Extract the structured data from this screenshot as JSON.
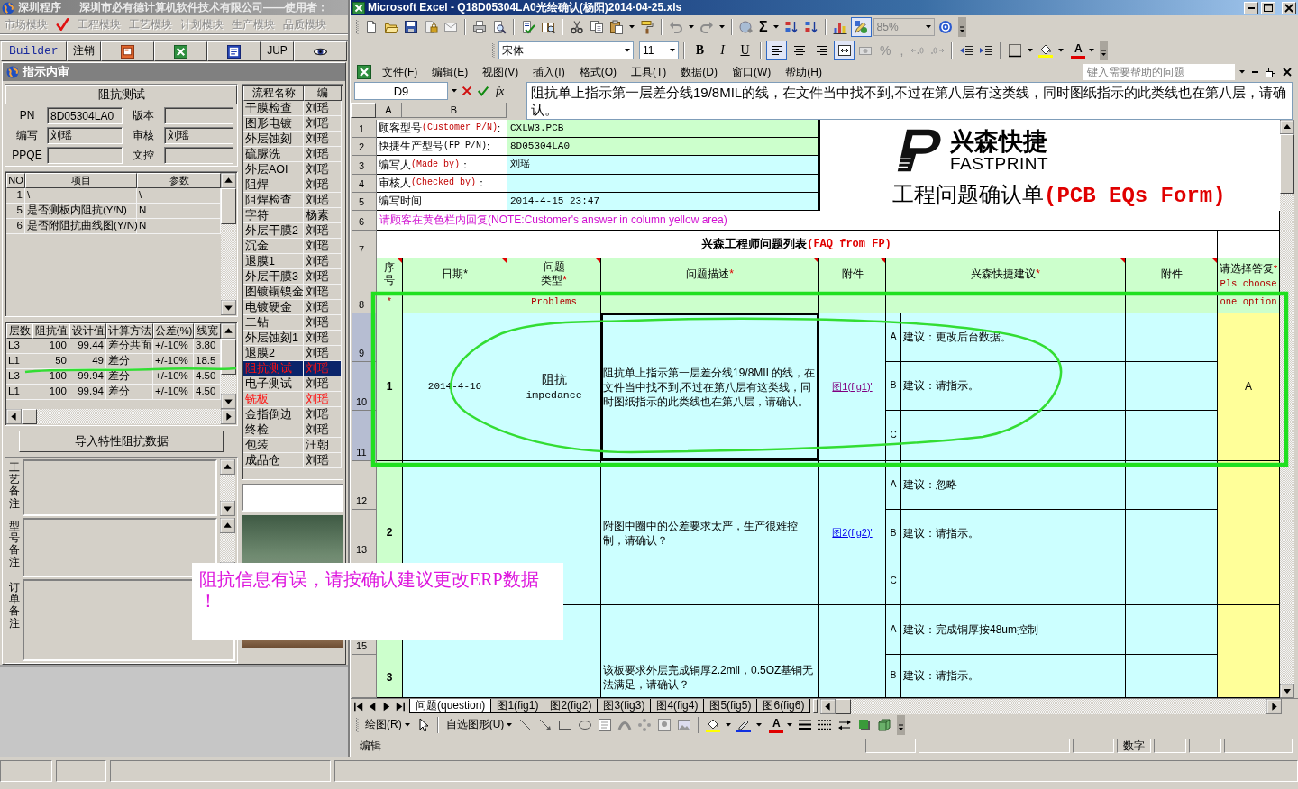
{
  "erp": {
    "title": {
      "app": "深圳程序",
      "company": "深圳市必有德计算机软件技术有限公司——使用者："
    },
    "modules": [
      {
        "label": "市场模块",
        "checked": false
      },
      {
        "label": "工程模块",
        "checked": true
      },
      {
        "label": "工艺模块",
        "checked": false
      },
      {
        "label": "计划模块",
        "checked": false
      },
      {
        "label": "生产模块",
        "checked": false
      },
      {
        "label": "品质模块",
        "checked": false
      }
    ],
    "toolbar": [
      {
        "kind": "text",
        "label": "Builder"
      },
      {
        "kind": "text",
        "label": "注销"
      },
      {
        "kind": "slides"
      },
      {
        "kind": "sheet"
      },
      {
        "kind": "doc"
      },
      {
        "kind": "text",
        "label": "JUP"
      },
      {
        "kind": "eye"
      }
    ],
    "window_title": "指示内审",
    "panel_title": "阻抗测试",
    "fields": [
      {
        "label": "PN",
        "value": "8D05304LA0"
      },
      {
        "label": "版本"
      },
      {
        "label": "编写",
        "value": "刘瑶"
      },
      {
        "label": "审核",
        "value": "刘瑶"
      },
      {
        "label": "PPQE"
      },
      {
        "label": "文控"
      }
    ],
    "items_table": {
      "columns": [
        "NO",
        "项目",
        "参数"
      ],
      "rows": [
        [
          "1",
          "\\",
          "\\"
        ],
        [
          "5",
          "是否测板内阻抗(Y/N)",
          "N"
        ],
        [
          "6",
          "是否附阻抗曲线图(Y/N)",
          "N"
        ]
      ]
    },
    "impedance_table": {
      "columns": [
        "层数",
        "阻抗值",
        "设计值",
        "计算方法",
        "公差(%)",
        "线宽"
      ],
      "rows": [
        [
          "L3",
          "100",
          "99.44",
          "差分共面",
          "+/-10%",
          "3.80"
        ],
        [
          "L1",
          "50",
          "49",
          "差分",
          "+/-10%",
          "18.5"
        ],
        [
          "L3",
          "100",
          "99.94",
          "差分",
          "+/-10%",
          "4.50"
        ],
        [
          "L1",
          "100",
          "99.94",
          "差分",
          "+/-10%",
          "4.50"
        ]
      ]
    },
    "import_button": "导入特性阻抗数据",
    "notes": [
      "工艺备注",
      "型号备注",
      "订单备注"
    ],
    "process_table": {
      "columns": [
        "流程名称",
        "编"
      ],
      "rows": [
        {
          "name": "干膜检查",
          "person": "刘瑶",
          "selected": false,
          "alert": false
        },
        {
          "name": "图形电镀",
          "person": "刘瑶",
          "selected": false,
          "alert": false
        },
        {
          "name": "外层蚀刻",
          "person": "刘瑶",
          "selected": false,
          "alert": false
        },
        {
          "name": "硫脲洗",
          "person": "刘瑶",
          "selected": false,
          "alert": false
        },
        {
          "name": "外层AOI",
          "person": "刘瑶",
          "selected": false,
          "alert": false
        },
        {
          "name": "阻焊",
          "person": "刘瑶",
          "selected": false,
          "alert": false
        },
        {
          "name": "阻焊检查",
          "person": "刘瑶",
          "selected": false,
          "alert": false
        },
        {
          "name": "字符",
          "person": "杨素",
          "selected": false,
          "alert": false
        },
        {
          "name": "外层干膜2",
          "person": "刘瑶",
          "selected": false,
          "alert": false
        },
        {
          "name": "沉金",
          "person": "刘瑶",
          "selected": false,
          "alert": false
        },
        {
          "name": "退膜1",
          "person": "刘瑶",
          "selected": false,
          "alert": false
        },
        {
          "name": "外层干膜3",
          "person": "刘瑶",
          "selected": false,
          "alert": false
        },
        {
          "name": "图镀铜镍金",
          "person": "刘瑶",
          "selected": false,
          "alert": false
        },
        {
          "name": "电镀硬金",
          "person": "刘瑶",
          "selected": false,
          "alert": false
        },
        {
          "name": "二钻",
          "person": "刘瑶",
          "selected": false,
          "alert": false
        },
        {
          "name": "外层蚀刻1",
          "person": "刘瑶",
          "selected": false,
          "alert": false
        },
        {
          "name": "退膜2",
          "person": "刘瑶",
          "selected": false,
          "alert": false
        },
        {
          "name": "阻抗测试",
          "person": "刘瑶",
          "selected": true,
          "alert": true
        },
        {
          "name": "电子测试",
          "person": "刘瑶",
          "selected": false,
          "alert": false
        },
        {
          "name": "铣板",
          "person": "刘瑶",
          "selected": false,
          "alert": true
        },
        {
          "name": "金指倒边",
          "person": "刘瑶",
          "selected": false,
          "alert": false
        },
        {
          "name": "终检",
          "person": "刘瑶",
          "selected": false,
          "alert": false
        },
        {
          "name": "包装",
          "person": "汪朝",
          "selected": false,
          "alert": false
        },
        {
          "name": "成品仓",
          "person": "刘瑶",
          "selected": false,
          "alert": false
        }
      ]
    }
  },
  "excel": {
    "title": "Microsoft Excel - Q18D05304LA0光绘确认(杨阳)2014-04-25.xls",
    "standard_toolbar": {
      "autosum": "Σ",
      "zoom": "85%",
      "drawing_pressed": true
    },
    "format_toolbar": {
      "font": "宋体",
      "size": "11",
      "styles": [
        "B",
        "I",
        "U"
      ],
      "alignment": [
        {
          "kind": "left",
          "pressed": true
        },
        {
          "kind": "center",
          "pressed": false
        },
        {
          "kind": "right",
          "pressed": false
        },
        {
          "kind": "merge",
          "pressed": true
        }
      ],
      "percent": "%",
      "comma": ",",
      "font_color": "A"
    },
    "menu": [
      "文件(F)",
      "编辑(E)",
      "视图(V)",
      "插入(I)",
      "格式(O)",
      "工具(T)",
      "数据(D)",
      "窗口(W)",
      "帮助(H)"
    ],
    "help_placeholder": "键入需要帮助的问题",
    "name_box": "D9",
    "function_label": "fx",
    "formula": "阻抗单上指示第一层差分线19/8MIL的线，在文件当中找不到,不过在第八层有这类线，同时图纸指示的此类线也在第八层，请确认。",
    "column_headers": [
      "A",
      "B"
    ],
    "row_headers": [
      {
        "label": "1",
        "selected": false
      },
      {
        "label": "2",
        "selected": false
      },
      {
        "label": "3",
        "selected": false
      },
      {
        "label": "4",
        "selected": false
      },
      {
        "label": "5",
        "selected": false
      },
      {
        "label": "6",
        "selected": false
      },
      {
        "label": "7",
        "selected": false
      },
      {
        "label": "8",
        "selected": false
      },
      {
        "label": "9",
        "selected": true
      },
      {
        "label": "10",
        "selected": true
      },
      {
        "label": "11",
        "selected": true
      },
      {
        "label": "12",
        "selected": false
      },
      {
        "label": "13",
        "selected": false
      },
      {
        "label": "15",
        "selected": false
      }
    ],
    "info": [
      {
        "zh": "顾客型号",
        "en": "(Customer P/N)",
        "accent": true,
        "tail": ":",
        "value": "CXLW3.PCB",
        "color": "#ccffcc"
      },
      {
        "zh": "快捷生产型号",
        "en": "(FP P/N)",
        "accent": false,
        "tail": ":",
        "value": "8D05304LA0",
        "color": "#ccffcc"
      },
      {
        "zh": "编写人",
        "en": "(Made by)",
        "accent": true,
        "tail": "：",
        "value": "刘瑶",
        "color": "#ccffff"
      },
      {
        "zh": "审核人",
        "en": "(Checked by)",
        "accent": true,
        "tail": "：",
        "color": "#ccffff"
      },
      {
        "zh": "编写时间",
        "value": "2014-4-15 23:47",
        "color": "#ccffff"
      }
    ],
    "brand": {
      "name": "兴森快捷",
      "latin": "FASTPRINT"
    },
    "form_title": {
      "zh": "工程问题确认单",
      "en": "(PCB EQs Form)"
    },
    "note": "请顾客在黄色栏内回复(NOTE:Customer's answer in column yellow area)",
    "list_title": {
      "zh": "兴森工程师问题列表",
      "en": "(FAQ from FP)"
    },
    "headers": [
      {
        "label": "序号",
        "sub": [
          "*"
        ],
        "comment": true
      },
      {
        "label": "日期*",
        "comment": true
      },
      {
        "label": "问题类型",
        "star": "*",
        "sub": [
          "Problems"
        ],
        "comment": true
      },
      {
        "label": "问题描述",
        "star": "*",
        "comment": true
      },
      {
        "label": "附件",
        "comment": true
      },
      {
        "label": "兴森快捷建议",
        "star": "*",
        "comment": true
      },
      {
        "label": "附件",
        "comment": true
      },
      {
        "label": "请选择答复",
        "star": "*",
        "sub": [
          "Pls choose",
          "one option"
        ],
        "comment": false
      }
    ],
    "items": [
      {
        "no": "1",
        "date": "2014-4-16",
        "type": {
          "zh": "阻抗",
          "en": "impedance"
        },
        "description": "阻抗单上指示第一层差分线19/8MIL的线，在文件当中找不到,不过在第八层有这类线，同时图纸指示的此类线也在第八层，请确认。",
        "selected": true,
        "attachment": {
          "label": "图1(fig1)'",
          "visited": true
        },
        "suggestions": [
          {
            "letter": "A",
            "text": "建议：更改后台数据。"
          },
          {
            "letter": "B",
            "text": "建议：请指示。"
          },
          {
            "letter": "C"
          }
        ],
        "answer": "A"
      },
      {
        "no": "2",
        "description": "附图中圈中的公差要求太严，生产很难控制，请确认？",
        "selected": false,
        "attachment": {
          "label": "图2(fig2)'",
          "visited": false
        },
        "suggestions": [
          {
            "letter": "A",
            "text": "建议：忽略"
          },
          {
            "letter": "B",
            "text": "建议：请指示。"
          },
          {
            "letter": "C"
          }
        ]
      },
      {
        "no": "3",
        "description": "该板要求外层完成铜厚2.2mil，0.5OZ基铜无法满足，请确认？",
        "selected": false,
        "suggestions": [
          {
            "letter": "A",
            "text": "建议：完成铜厚按48um控制"
          },
          {
            "letter": "B",
            "text": "建议：请指示。"
          }
        ]
      }
    ],
    "sheet_tabs": [
      {
        "label": "问题(question)",
        "selected": true
      },
      {
        "label": "图1(fig1)",
        "selected": false
      },
      {
        "label": "图2(fig2)",
        "selected": false
      },
      {
        "label": "图3(fig3)",
        "selected": false
      },
      {
        "label": "图4(fig4)",
        "selected": false
      },
      {
        "label": "图5(fig5)",
        "selected": false
      },
      {
        "label": "图6(fig6)",
        "selected": false
      }
    ],
    "drawing_toolbar": {
      "draw": "绘图(R)",
      "autoshapes": "自选图形(U)",
      "font_color": "A"
    },
    "status": {
      "mode": "编辑",
      "keys": "数字"
    }
  },
  "popup": {
    "message": "阻抗信息有误，请按确认建议更改ERP数据！"
  }
}
